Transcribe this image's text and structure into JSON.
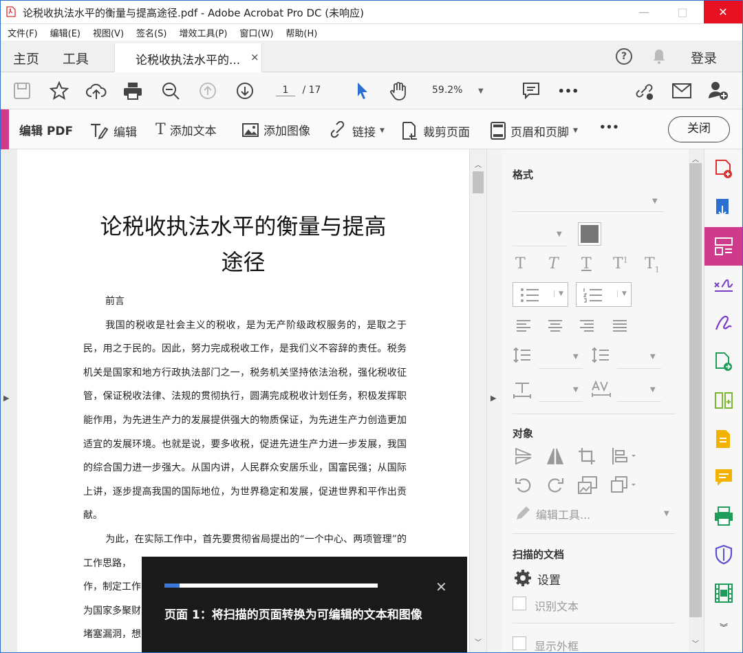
{
  "window": {
    "title": "论税收执法水平的衡量与提高途径.pdf - Adobe Acrobat Pro DC (未响应)",
    "minimize": "—",
    "maximize": "□",
    "close": "✕"
  },
  "menu": [
    "文件(F)",
    "编辑(E)",
    "视图(V)",
    "签名(S)",
    "增效工具(P)",
    "窗口(W)",
    "帮助(H)"
  ],
  "tabs": {
    "home": "主页",
    "tools": "工具",
    "doc": "论税收执法水平的...",
    "doc_close": "×",
    "help": "?",
    "login": "登录"
  },
  "toolbar": {
    "page_current": "1",
    "page_total": "/ 17",
    "zoom": "59.2%",
    "more": "•••"
  },
  "editbar": {
    "title": "编辑 PDF",
    "edit": "编辑",
    "add_text": "添加文本",
    "add_image": "添加图像",
    "link": "链接",
    "crop": "裁剪页面",
    "header_footer": "页眉和页脚",
    "more": "•••",
    "close": "关闭"
  },
  "document": {
    "title_line1": "论税收执法水平的衡量与提高",
    "title_line2": "途径",
    "preface": "前言",
    "para1": "我国的税收是社会主义的税收，是为无产阶级政权服务的，是取之于民，用之于民的。因此，努力完成税收工作，是我们义不容辞的责任。税务机关是国家和地方行政执法部门之一，税务机关坚持依法治税，强化税收征管，保证税收法律、法规的贯彻执行，圆满完成税收计划任务，积极发挥职能作用，为先进生产力的发展提供强大的物质保证，为先进生产力创造更加适宜的发展环境。也就是说，要多收税，促进先进生产力进一步发展，我国的综合国力进一步强大。从国内讲，人民群众安居乐业，国富民强；从国际上讲，逐步提高我国的国际地位，为世界稳定和发展，促进世界和平作出贡献。",
    "para2": "为此，在实际工作中，首先要贯彻省局提出的“一个中心、两项管理”的工作思路，",
    "line_a": "作，制定工作",
    "line_b": "为国家多聚财",
    "line_c": "堵塞漏洞，想"
  },
  "panel": {
    "format": "格式",
    "objects": "对象",
    "edit_tools": "编辑工具...",
    "scanned": "扫描的文档",
    "settings": "设置",
    "recognize": "识别文本",
    "show_frame": "显示外框",
    "T": "T",
    "T2": "T",
    "T3": "T",
    "Tsup": "T",
    "Tsup_mark": "1",
    "Tsub": "T",
    "Tsub_mark": "1"
  },
  "toast": {
    "progress": 0.07,
    "message": "页面 1：将扫描的页面转换为可编辑的文本和图像",
    "close": "✕"
  },
  "colors": {
    "accent": "#cf3a8a",
    "selection_blue": "#2b6fd1"
  }
}
